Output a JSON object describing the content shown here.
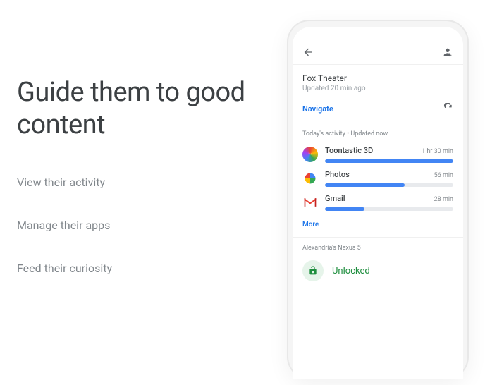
{
  "headline": "Guide them to good content",
  "menu": {
    "activity": "View their activity",
    "apps": "Manage their apps",
    "curiosity": "Feed their curiosity"
  },
  "phone": {
    "location_card": {
      "title": "Fox Theater",
      "subtitle": "Updated 20 min ago",
      "navigate_label": "Navigate"
    },
    "activity": {
      "header": "Today's activity • Updated now",
      "apps": [
        {
          "name": "Toontastic 3D",
          "time": "1 hr 30 min",
          "pct": 100
        },
        {
          "name": "Photos",
          "time": "56 min",
          "pct": 62
        },
        {
          "name": "Gmail",
          "time": "28 min",
          "pct": 31
        }
      ],
      "more_label": "More"
    },
    "device": {
      "header": "Alexandria's Nexus 5",
      "status": "Unlocked"
    }
  },
  "chart_data": {
    "type": "bar",
    "title": "Today's activity",
    "categories": [
      "Toontastic 3D",
      "Photos",
      "Gmail"
    ],
    "values": [
      90,
      56,
      28
    ],
    "ylabel": "Minutes",
    "ylim": [
      0,
      90
    ]
  }
}
